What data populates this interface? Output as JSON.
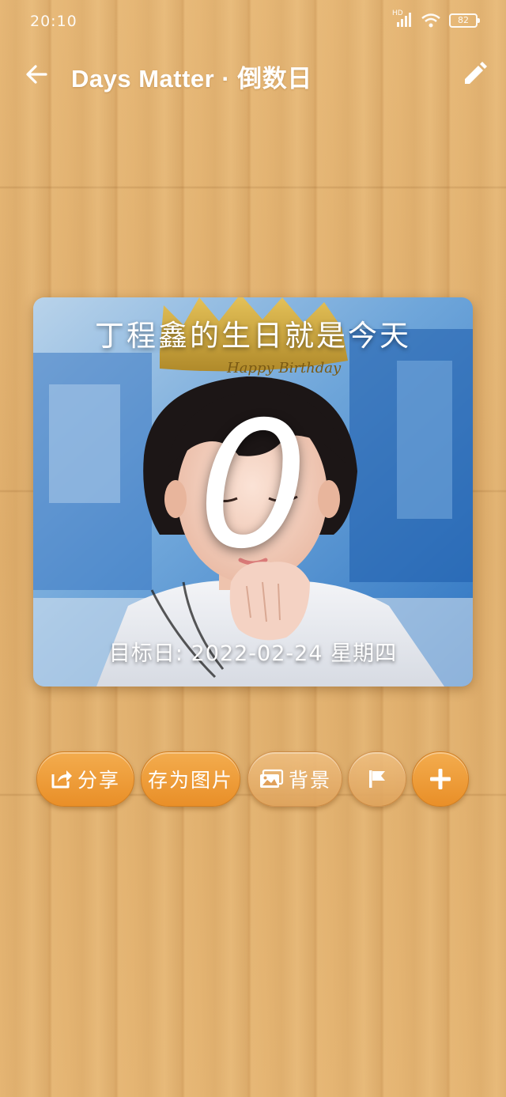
{
  "status_bar": {
    "time": "20:10",
    "network_label": "HD",
    "battery": "82"
  },
  "app_bar": {
    "title": "Days Matter · 倒数日",
    "back_icon": "arrow-left-icon",
    "edit_icon": "pencil-icon"
  },
  "event_card": {
    "title": "丁程鑫的生日就是今天",
    "days": "0",
    "target_date": "目标日: 2022-02-24 星期四",
    "crown_text": "Happy Birthday"
  },
  "actions": {
    "share_label": "分享",
    "save_image_label": "存为图片",
    "background_label": "背景",
    "flag_icon": "flag-icon",
    "add_icon": "plus-icon"
  },
  "colors": {
    "accent_orange": "#ec9a35",
    "wood": "#e3b270"
  }
}
